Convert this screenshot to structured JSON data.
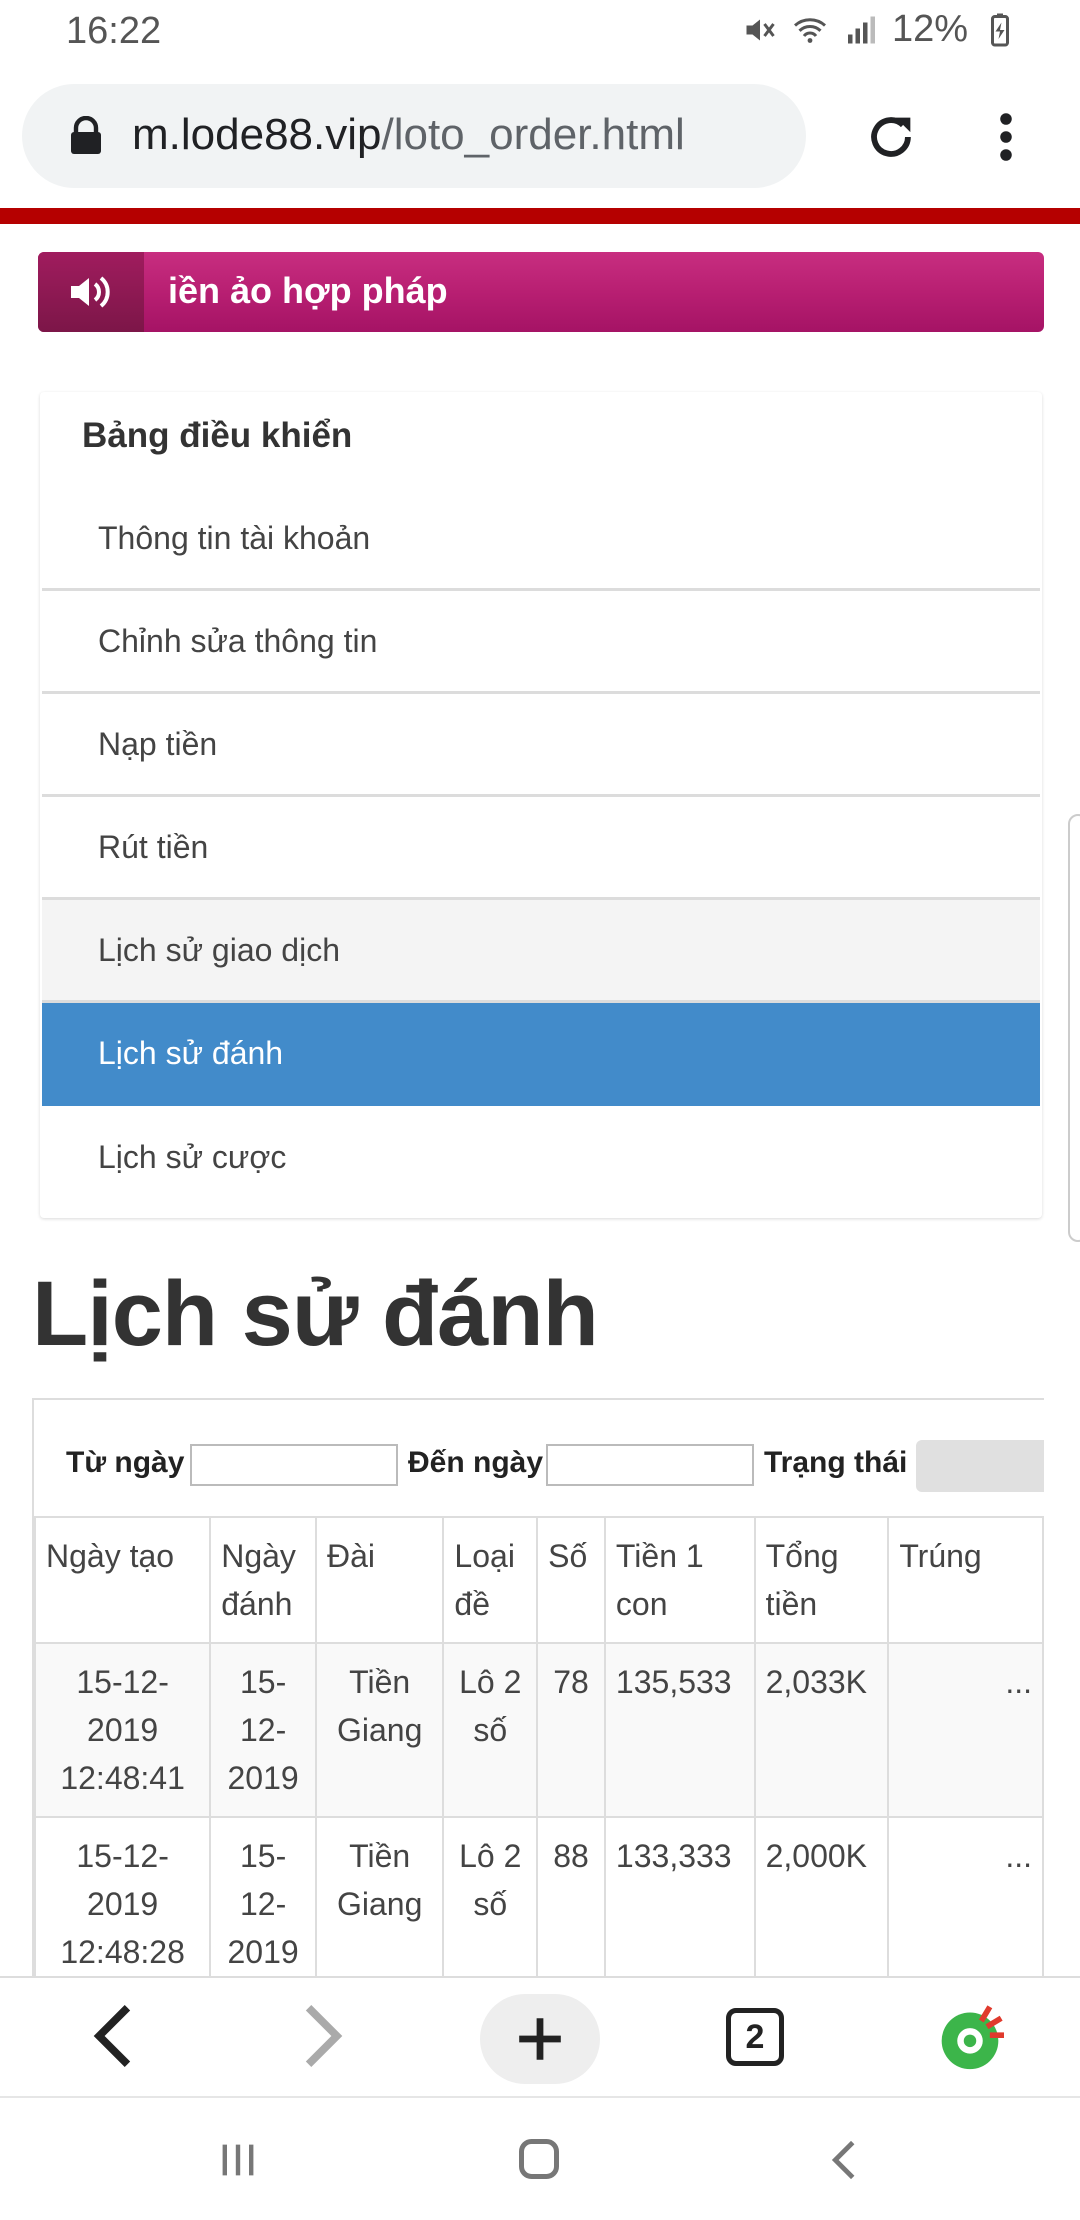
{
  "status_bar": {
    "time": "16:22",
    "battery": "12%"
  },
  "browser": {
    "url_domain": "m.lode88.vip",
    "url_path": "/loto_order.html",
    "tab_count": "2"
  },
  "banner": {
    "text": "iền ảo hợp pháp"
  },
  "sidebar": {
    "title": "Bảng điều khiển",
    "items": [
      {
        "label": "Thông tin tài khoản"
      },
      {
        "label": "Chỉnh sửa thông tin"
      },
      {
        "label": "Nạp tiền"
      },
      {
        "label": "Rút tiền"
      },
      {
        "label": "Lịch sử giao dịch"
      },
      {
        "label": "Lịch sử đánh"
      },
      {
        "label": "Lịch sử cược"
      }
    ]
  },
  "main": {
    "heading": "Lịch sử đánh",
    "filters": {
      "from_label": "Từ ngày",
      "to_label": "Đến ngày",
      "status_label": "Trạng thái",
      "from_value": "",
      "to_value": ""
    },
    "table": {
      "headers": [
        "Ngày tạo",
        "Ngày đánh",
        "Đài",
        "Loại đề",
        "Số",
        "Tiền 1 con",
        "Tổng tiền",
        "Trúng"
      ],
      "rows": [
        {
          "created": "15-12-2019 12:48:41",
          "date": "15-12-2019",
          "station": "Tiền Giang",
          "type": "Lô 2 số",
          "number": "78",
          "per_unit": "135,533",
          "total": "2,033K",
          "win": "..."
        },
        {
          "created": "15-12-2019 12:48:28",
          "date": "15-12-2019",
          "station": "Tiền Giang",
          "type": "Lô 2 số",
          "number": "88",
          "per_unit": "133,333",
          "total": "2,000K",
          "win": "..."
        }
      ]
    }
  }
}
